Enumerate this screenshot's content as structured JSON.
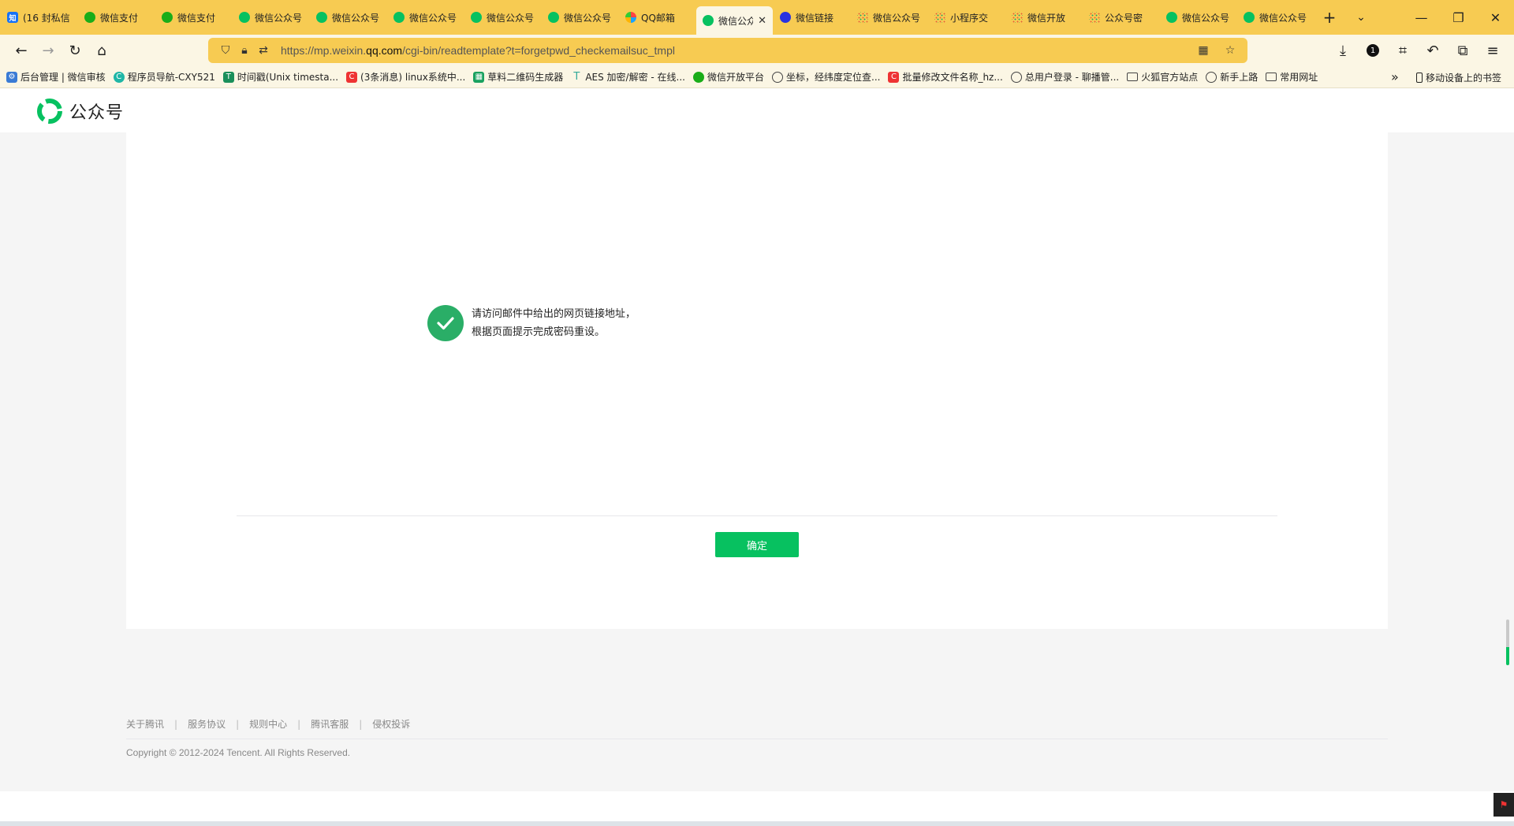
{
  "browser": {
    "tabs": [
      {
        "title": "(16 封私信",
        "icon": "zhihu-icon",
        "active": false
      },
      {
        "title": "微信支付",
        "icon": "wechat-pay-icon",
        "active": false
      },
      {
        "title": "微信支付",
        "icon": "wechat-pay-icon",
        "active": false
      },
      {
        "title": "微信公众号",
        "icon": "wechat-icon",
        "active": false
      },
      {
        "title": "微信公众号",
        "icon": "wechat-icon",
        "active": false
      },
      {
        "title": "微信公众号",
        "icon": "wechat-icon",
        "active": false
      },
      {
        "title": "微信公众号",
        "icon": "wechat-icon",
        "active": false
      },
      {
        "title": "微信公众号",
        "icon": "wechat-icon",
        "active": false
      },
      {
        "title": "QQ邮箱",
        "icon": "qqmail-icon",
        "active": false
      },
      {
        "title": "微信公众",
        "icon": "wechat-icon",
        "active": true
      },
      {
        "title": "微信链接",
        "icon": "baidu-icon",
        "active": false
      },
      {
        "title": "微信公众号",
        "icon": "apps-grid-icon",
        "active": false
      },
      {
        "title": "小程序交",
        "icon": "apps-grid-icon",
        "active": false
      },
      {
        "title": "微信开放",
        "icon": "apps-grid-icon",
        "active": false
      },
      {
        "title": "公众号密",
        "icon": "apps-grid-icon",
        "active": false
      },
      {
        "title": "微信公众号",
        "icon": "wechat-icon",
        "active": false
      },
      {
        "title": "微信公众号",
        "icon": "wechat-icon",
        "active": false
      }
    ],
    "url": "https://mp.weixin.qq.com/cgi-bin/readtemplate?t=forgetpwd_checkemailsuc_tmpl",
    "url_prefix": "https://mp.weixin.",
    "url_host": "qq.com",
    "url_path": "/cgi-bin/readtemplate?t=forgetpwd_checkemailsuc_tmpl",
    "downloads_badge": "1",
    "bookmarks": [
      {
        "label": "后台管理 | 微信审核",
        "icon": "gear-icon"
      },
      {
        "label": "程序员导航-CXY521",
        "icon": "c-logo-icon"
      },
      {
        "label": "时间戳(Unix timesta...",
        "icon": "t-logo-icon"
      },
      {
        "label": "(3条消息) linux系统中...",
        "icon": "csdn-icon"
      },
      {
        "label": "草料二维码生成器",
        "icon": "qr-icon"
      },
      {
        "label": "AES 加密/解密 - 在线...",
        "icon": "t-pin-icon"
      },
      {
        "label": "微信开放平台",
        "icon": "wechat-icon"
      },
      {
        "label": "坐标，经纬度定位查...",
        "icon": "globe-icon"
      },
      {
        "label": "批量修改文件名称_hz...",
        "icon": "csdn-icon"
      },
      {
        "label": "总用户登录 - 聊播管...",
        "icon": "globe-icon"
      },
      {
        "label": "火狐官方站点",
        "icon": "folder-icon"
      },
      {
        "label": "新手上路",
        "icon": "globe-icon"
      },
      {
        "label": "常用网址",
        "icon": "folder-icon"
      }
    ],
    "mobile_bookmarks": "移动设备上的书签"
  },
  "page": {
    "logo_text": "公众号",
    "message_line1": "请访问邮件中给出的网页链接地址，",
    "message_line2": "根据页面提示完成密码重设。",
    "confirm_label": "确定",
    "footer_links": [
      "关于腾讯",
      "服务协议",
      "规则中心",
      "腾讯客服",
      "侵权投诉"
    ],
    "copyright": "Copyright © 2012-2024 Tencent. All Rights Reserved."
  },
  "colors": {
    "chrome": "#f7cb52",
    "toolbar": "#fbf6e4",
    "accent_green": "#07c160",
    "check_green": "#2aae67"
  }
}
